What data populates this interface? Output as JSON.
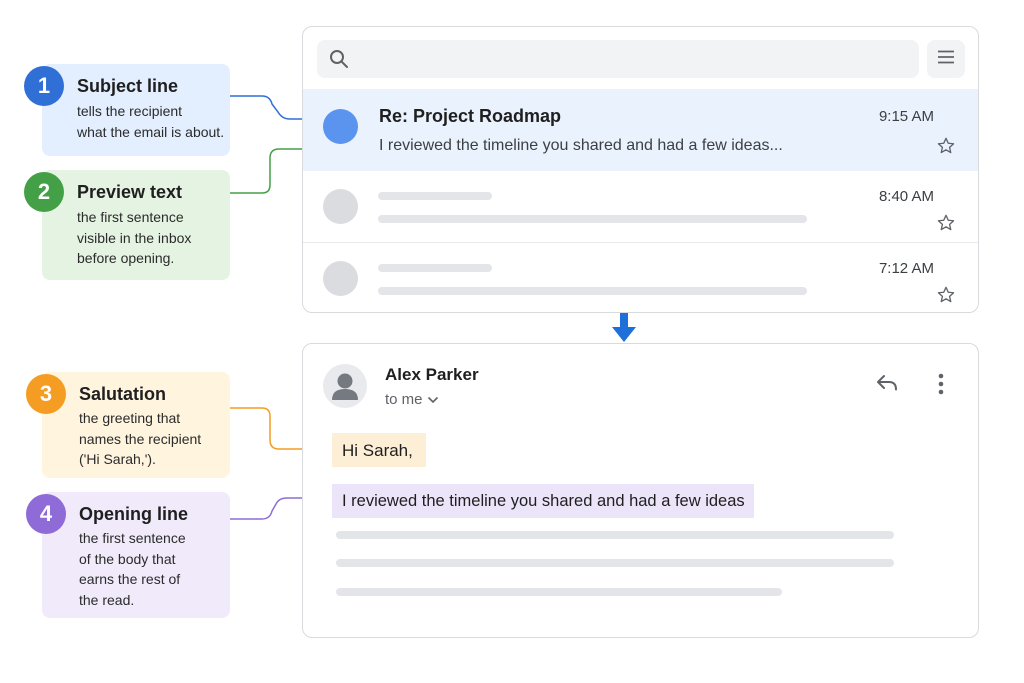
{
  "colors": {
    "step1": "#2f6fd6",
    "step2": "#43a047",
    "step3": "#f59c22",
    "step4": "#8e6bd6",
    "callout1_bg": "#e3efff",
    "callout2_bg": "#e5f4e2",
    "callout3_bg": "#fff4de",
    "callout4_bg": "#f0eafb"
  },
  "callouts": [
    {
      "number": "1",
      "title": "Subject line",
      "desc": "tells the recipient\nwhat the email is about."
    },
    {
      "number": "2",
      "title": "Preview text",
      "desc": "the first sentence\nvisible in the inbox\nbefore opening."
    },
    {
      "number": "3",
      "title": "Salutation",
      "desc": "the greeting that\nnames the recipient\n('Hi Sarah,')."
    },
    {
      "number": "4",
      "title": "Opening line",
      "desc": "the first sentence\nof the body that\nearns the rest of\nthe read."
    }
  ],
  "inbox": {
    "icons": {
      "search": "search-icon",
      "menu": "menu-icon",
      "star": "star-icon"
    },
    "rows": [
      {
        "subject": "Re: Project Roadmap",
        "preview": "I reviewed the timeline you shared and had a few ideas...",
        "time": "9:15 AM"
      },
      {
        "time": "8:40 AM"
      },
      {
        "time": "7:12 AM"
      }
    ]
  },
  "email": {
    "sender": "Alex Parker",
    "recipient": "to me",
    "salutation": "Hi Sarah,",
    "opening_line": "I reviewed the timeline you shared and had a few ideas",
    "icons": {
      "avatar": "person-icon",
      "reply": "reply-icon",
      "more": "more-vert-icon",
      "expand": "chevron-down-icon"
    }
  }
}
